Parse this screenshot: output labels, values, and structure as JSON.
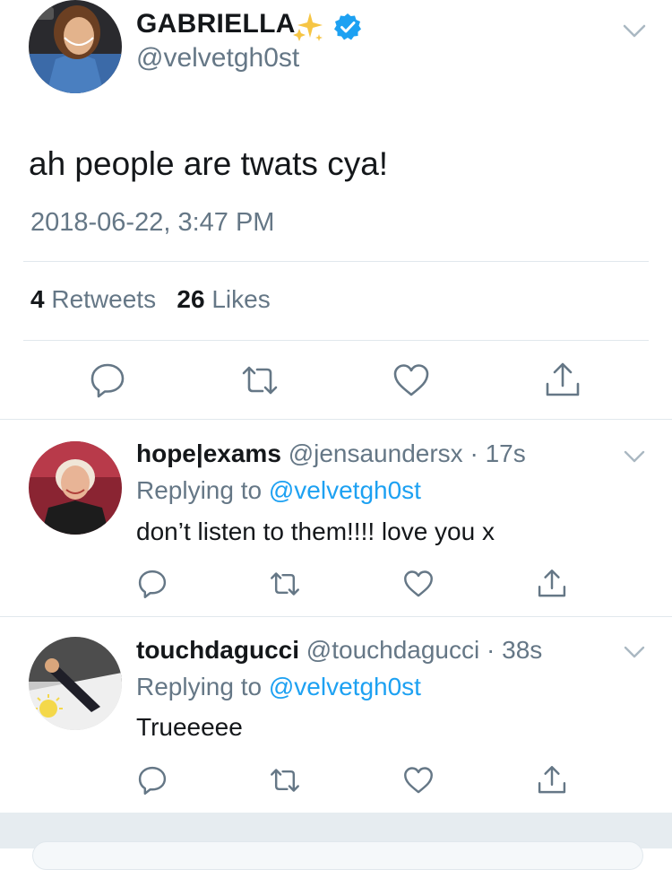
{
  "main_tweet": {
    "display_name": "GABRIELLA",
    "handle": "@velvetgh0st",
    "text": "ah people are twats cya!",
    "timestamp": "2018-06-22, 3:47 PM",
    "retweet_count": "4",
    "retweet_label": "Retweets",
    "like_count": "26",
    "like_label": "Likes",
    "badges": [
      "sparkles-icon",
      "verified-icon"
    ]
  },
  "replies": [
    {
      "name": "hope|exams",
      "handle": "@jensaundersx",
      "time": "17s",
      "replying_prefix": "Replying to ",
      "replying_to": "@velvetgh0st",
      "text": "don’t listen to them!!!! love you x"
    },
    {
      "name": "touchdagucci",
      "handle": "@touchdagucci",
      "time": "38s",
      "replying_prefix": "Replying to ",
      "replying_to": "@velvetgh0st",
      "text": "Trueeeee"
    }
  ],
  "icons": {
    "reply": "reply-icon",
    "retweet": "retweet-icon",
    "like": "heart-icon",
    "share": "share-icon",
    "more": "chevron-down-icon"
  },
  "colors": {
    "text": "#14171a",
    "secondary": "#657786",
    "accent": "#1da1f2",
    "divider": "#e1e8ed",
    "icon": "#657786"
  }
}
